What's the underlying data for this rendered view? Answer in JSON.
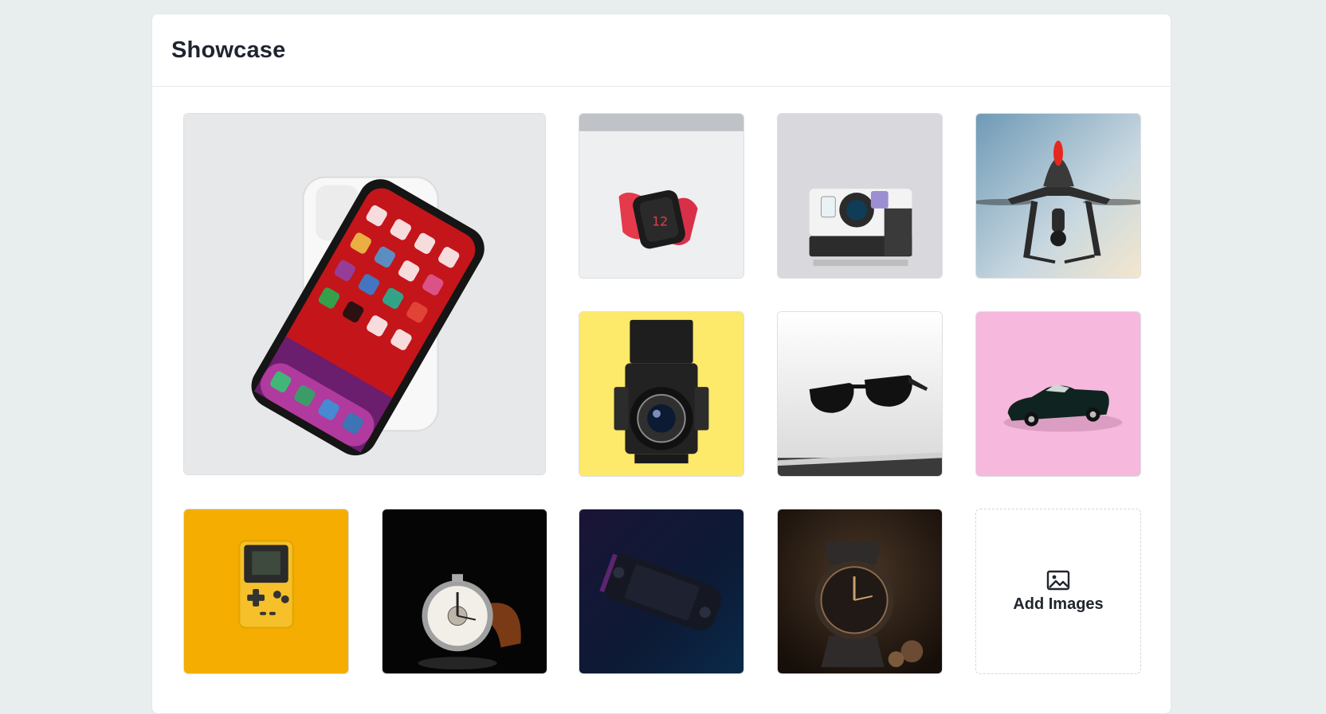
{
  "showcase": {
    "title": "Showcase",
    "add_label": "Add Images",
    "add_icon": "image-icon"
  },
  "images": [
    {
      "subject": "phone",
      "bg": "#e9eaec"
    },
    {
      "subject": "smartwatch",
      "bg": "#eeeff1"
    },
    {
      "subject": "instant-camera",
      "bg": "#d9d8dc"
    },
    {
      "subject": "drone",
      "bg": "#aebfd0"
    },
    {
      "subject": "medium-format-camera",
      "bg": "#fde96a"
    },
    {
      "subject": "sunglasses",
      "bg": "#f0f0f0"
    },
    {
      "subject": "toy-car",
      "bg": "#f6b8dc"
    },
    {
      "subject": "handheld-console",
      "bg": "#f4ad00"
    },
    {
      "subject": "chronograph-watch",
      "bg": "#050505"
    },
    {
      "subject": "gaming-handheld",
      "bg": "#0d1a33"
    },
    {
      "subject": "leather-watch",
      "bg": "#2a1d14"
    }
  ]
}
